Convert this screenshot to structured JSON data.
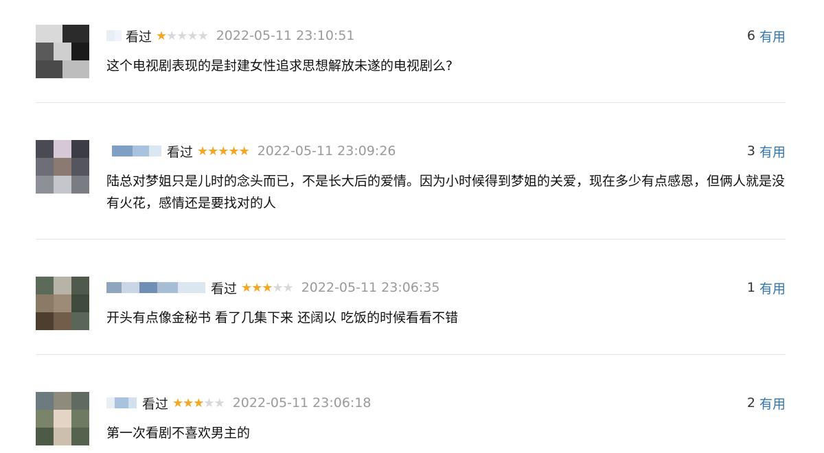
{
  "reviews": [
    {
      "watched": "看过",
      "rating": 1,
      "time": "2022-05-11 23:10:51",
      "useful_count": "6",
      "useful_label": "有用",
      "comment": "这个电视剧表现的是封建女性追求思想解放未遂的电视剧么?"
    },
    {
      "watched": "看过",
      "rating": 5,
      "time": "2022-05-11 23:09:26",
      "useful_count": "3",
      "useful_label": "有用",
      "comment": "陆总对梦姐只是儿时的念头而已，不是长大后的爱情。因为小时候得到梦姐的关爱，现在多少有点感恩，但俩人就是没有火花，感情还是要找对的人"
    },
    {
      "watched": "看过",
      "rating": 3,
      "time": "2022-05-11 23:06:35",
      "useful_count": "1",
      "useful_label": "有用",
      "comment": "开头有点像金秘书 看了几集下来 还阔以 吃饭的时候看看不错"
    },
    {
      "watched": "看过",
      "rating": 3,
      "time": "2022-05-11 23:06:18",
      "useful_count": "2",
      "useful_label": "有用",
      "comment": "第一次看剧不喜欢男主的"
    }
  ],
  "colors": {
    "star_on": "#f5a623",
    "star_off": "#d8d8d8",
    "link": "#3377aa",
    "time": "#999999"
  }
}
